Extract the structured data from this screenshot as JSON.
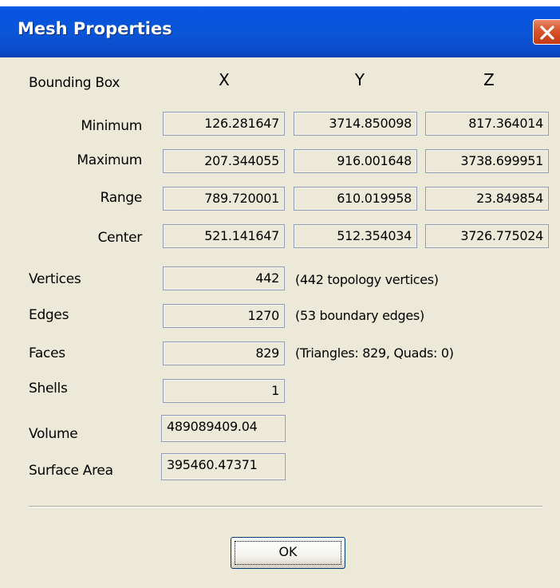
{
  "window": {
    "title": "Mesh Properties"
  },
  "bounding_box": {
    "label": "Bounding Box",
    "axes": [
      "X",
      "Y",
      "Z"
    ],
    "rows": [
      {
        "label": "Minimum",
        "values": [
          "126.281647",
          "3714.850098",
          "817.364014"
        ]
      },
      {
        "label": "Maximum",
        "values": [
          "207.344055",
          "916.001648",
          "3738.699951"
        ]
      },
      {
        "label": "Range",
        "values": [
          "789.720001",
          "610.019958",
          "23.849854"
        ]
      },
      {
        "label": "Center",
        "values": [
          "521.141647",
          "512.354034",
          "3726.775024"
        ]
      }
    ]
  },
  "stats": [
    {
      "label": "Vertices",
      "value": "442",
      "note": "(442 topology vertices)"
    },
    {
      "label": "Edges",
      "value": "1270",
      "note": "(53 boundary edges)"
    },
    {
      "label": "Faces",
      "value": "829",
      "note": "(Triangles: 829, Quads: 0)"
    },
    {
      "label": "Shells",
      "value": "1",
      "note": ""
    },
    {
      "label": "Volume",
      "value": "489089409.04",
      "note": ""
    },
    {
      "label": "Surface Area",
      "value": "395460.47371",
      "note": ""
    }
  ],
  "buttons": {
    "ok": "OK"
  },
  "colors": {
    "titlebar": "#0a56d8",
    "close_button": "#d8552a",
    "dialog_background": "#ece9d8",
    "field_border": "#8c9db5"
  },
  "icons": {
    "close": "close-icon"
  }
}
